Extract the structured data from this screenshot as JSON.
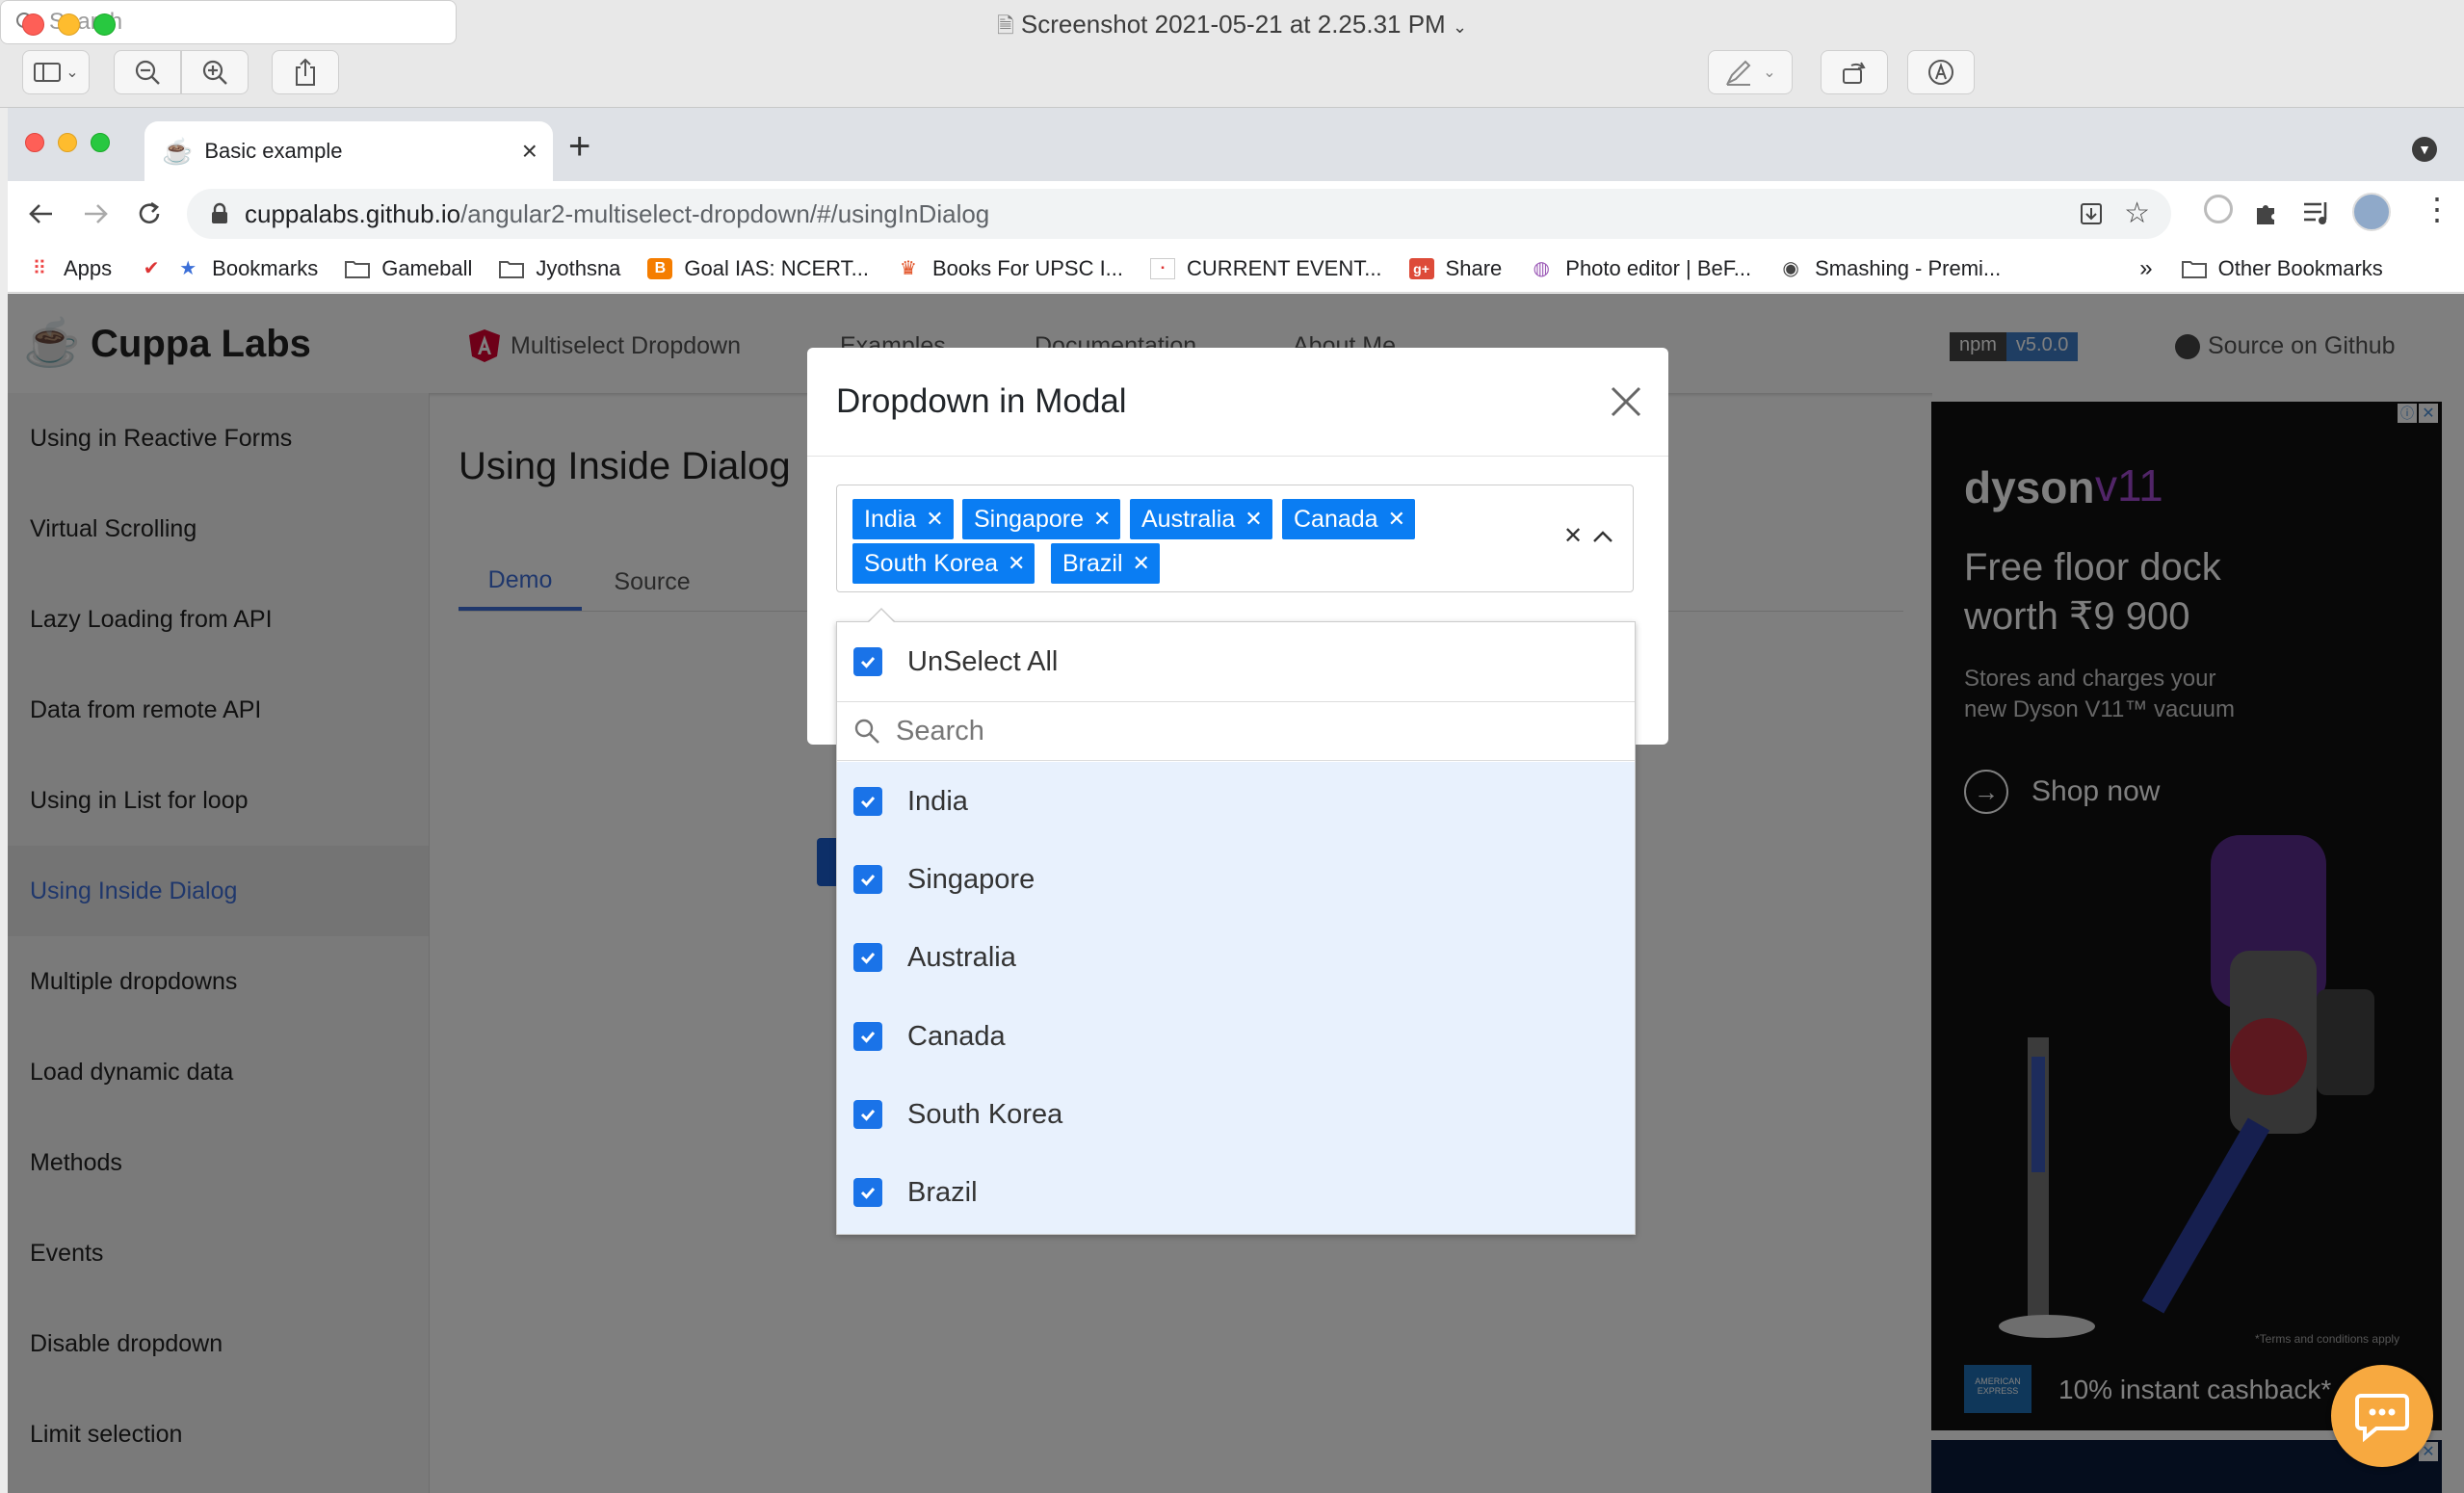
{
  "preview": {
    "title": "Screenshot 2021-05-21 at 2.25.31 PM",
    "search_placeholder": "Search"
  },
  "browser": {
    "tab_title": "Basic example",
    "url_host": "cuppalabs.github.io",
    "url_path": "/angular2-multiselect-dropdown/#/usingInDialog",
    "bookmarks": [
      "Apps",
      "Bookmarks",
      "Gameball",
      "Jyothsna",
      "Goal IAS: NCERT...",
      "Books For UPSC I...",
      "CURRENT EVENT...",
      "Share",
      "Photo editor | BeF...",
      "Smashing - Premi..."
    ],
    "other_bookmarks": "Other Bookmarks",
    "overflow": "»"
  },
  "site": {
    "brand": "Cuppa Labs",
    "nav": [
      "Multiselect Dropdown",
      "Examples",
      "Documentation",
      "About Me"
    ],
    "npm_label": "npm",
    "npm_version": "v5.0.0",
    "github_link": "Source on Github"
  },
  "sidebar": {
    "items": [
      {
        "label": "Using in Reactive Forms"
      },
      {
        "label": "Virtual Scrolling"
      },
      {
        "label": "Lazy Loading from API"
      },
      {
        "label": "Data from remote API"
      },
      {
        "label": "Using in List for loop"
      },
      {
        "label": "Using Inside Dialog",
        "active": true
      },
      {
        "label": "Multiple dropdowns"
      },
      {
        "label": "Load dynamic data"
      },
      {
        "label": "Methods"
      },
      {
        "label": "Events"
      },
      {
        "label": "Disable dropdown"
      },
      {
        "label": "Limit selection"
      }
    ]
  },
  "main": {
    "heading": "Using Inside Dialog",
    "tabs": [
      "Demo",
      "Source"
    ],
    "active_tab": "Demo"
  },
  "modal": {
    "title": "Dropdown in Modal",
    "selected": [
      "India",
      "Singapore",
      "Australia",
      "Canada",
      "South Korea",
      "Brazil"
    ],
    "unselect_all": "UnSelect All",
    "search_placeholder": "Search",
    "options": [
      {
        "label": "India",
        "checked": true
      },
      {
        "label": "Singapore",
        "checked": true
      },
      {
        "label": "Australia",
        "checked": true
      },
      {
        "label": "Canada",
        "checked": true
      },
      {
        "label": "South Korea",
        "checked": true
      },
      {
        "label": "Brazil",
        "checked": true
      }
    ]
  },
  "ad": {
    "brand": "dyson",
    "model": "v11",
    "headline_line1": "Free floor dock",
    "headline_line2": "worth ₹9 900",
    "sub_line1": "Stores and charges your",
    "sub_line2": "new Dyson V11™ vacuum",
    "cta": "Shop now",
    "terms": "*Terms and conditions apply",
    "sponsor": "AMERICAN EXPRESS",
    "cashback": "10% instant cashback*"
  },
  "colors": {
    "accent": "#3f6fd8",
    "chip": "#0a7df3",
    "checkbox": "#1a73e8",
    "option_bg": "#e8f1fd",
    "npm_version_bg": "#3e7cc6"
  }
}
